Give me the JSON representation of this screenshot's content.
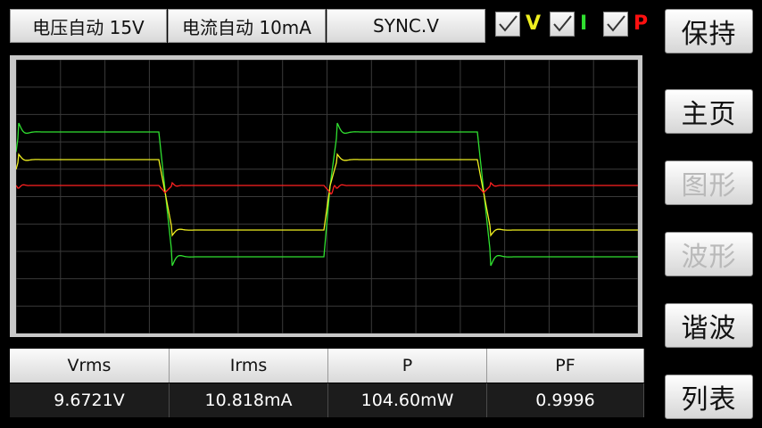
{
  "top_bar": {
    "voltage_range": "电压自动 15V",
    "current_range": "电流自动 10mA",
    "sync_source": "SYNC.V"
  },
  "channels": [
    {
      "label": "V",
      "checked": true,
      "color": "#f0f020"
    },
    {
      "label": "I",
      "checked": true,
      "color": "#30e030"
    },
    {
      "label": "P",
      "checked": true,
      "color": "#ff1010"
    }
  ],
  "side_menu": {
    "hold": "保持",
    "home": "主页",
    "graph": "图形",
    "waveform": "波形",
    "harmonics": "谐波",
    "list": "列表"
  },
  "measurements": {
    "headers": [
      "Vrms",
      "Irms",
      "P",
      "PF"
    ],
    "values": [
      "9.6721V",
      "10.818mA",
      "104.60mW",
      "0.9996"
    ]
  },
  "colors": {
    "voltage_trace": "#f0f020",
    "current_trace": "#30e030",
    "power_trace": "#ff2020",
    "grid": "#3a3a3a",
    "background": "#000000"
  }
}
